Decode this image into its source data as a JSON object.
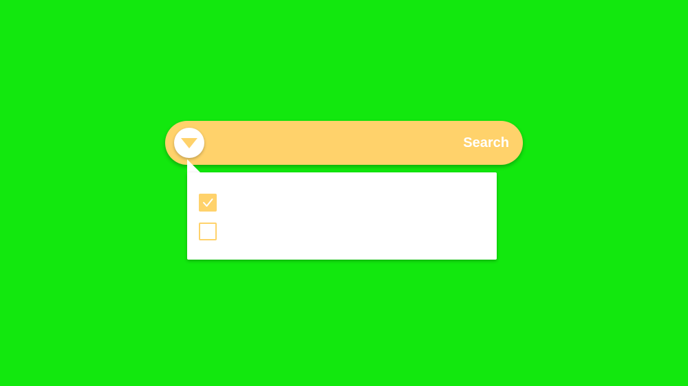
{
  "colors": {
    "background": "#12e80e",
    "accent": "#ffd26b",
    "panel": "#ffffff",
    "label": "#ffffff"
  },
  "search_bar": {
    "label": "Search",
    "toggle_icon": "triangle-down-icon"
  },
  "dropdown": {
    "options": [
      {
        "checked": true,
        "icon": "checkmark-icon"
      },
      {
        "checked": false
      }
    ]
  }
}
